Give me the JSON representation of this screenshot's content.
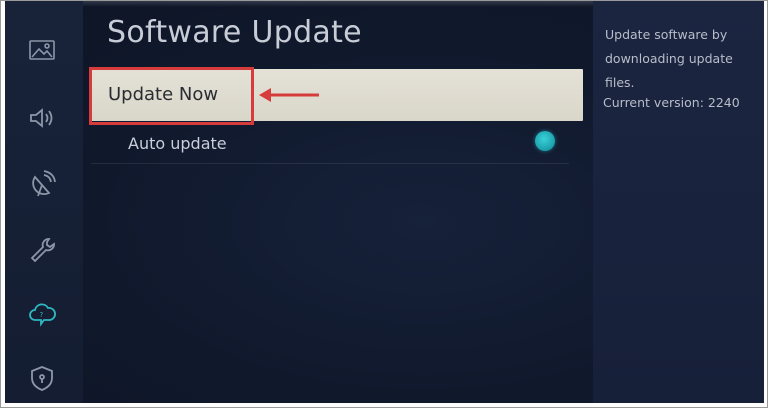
{
  "page": {
    "title": "Software Update"
  },
  "menu": {
    "update_now_label": "Update Now",
    "auto_update_label": "Auto update",
    "auto_update_enabled": true
  },
  "info": {
    "description": "Update software by downloading update files.",
    "current_version": "Current version: 2240"
  },
  "sidebar": {
    "icons": [
      "picture-icon",
      "sound-icon",
      "broadcasting-icon",
      "tools-icon",
      "support-cloud-icon",
      "privacy-shield-icon"
    ]
  },
  "annotation": {
    "highlight_color": "#d63c3c"
  },
  "colors": {
    "toggle_on": "#1fa6b3",
    "highlight_bg": "#e0ddd2"
  }
}
